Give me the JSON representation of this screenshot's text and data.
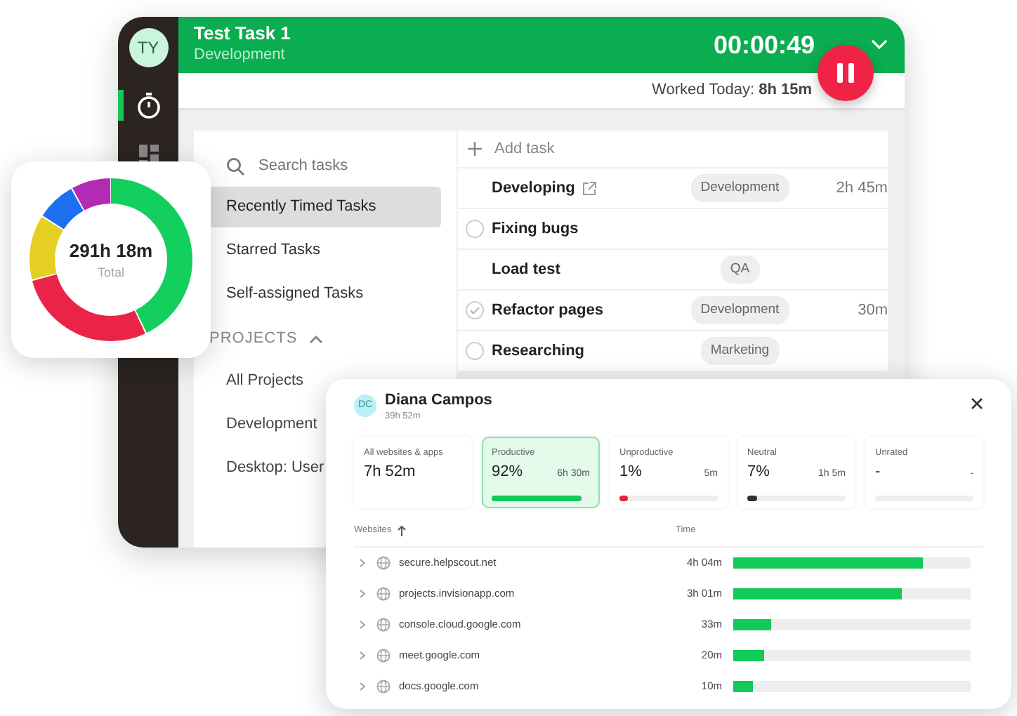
{
  "timer": {
    "avatar": "TY",
    "task": "Test Task 1",
    "project": "Development",
    "elapsed": "00:00:49",
    "worked_today": "Worked Today: **8h 15m**"
  },
  "search": {
    "placeholder": "Search tasks"
  },
  "task_filters": [
    {
      "label": "Recently Timed Tasks",
      "selected": true
    },
    {
      "label": "Starred Tasks",
      "selected": false
    },
    {
      "label": "Self-assigned Tasks",
      "selected": false
    }
  ],
  "projects": {
    "heading": "PROJECTS",
    "expanded": true,
    "items": [
      {
        "label": "All Projects"
      },
      {
        "label": "Development"
      },
      {
        "label": "Desktop: User"
      }
    ]
  },
  "add_task": "Add task",
  "tasks": [
    {
      "name": "Developing",
      "kind": "running",
      "tag": "Development",
      "time": "2h 45m"
    },
    {
      "name": "Fixing bugs",
      "kind": "todo"
    },
    {
      "name": "Load test",
      "kind": "plain",
      "tag": "QA"
    },
    {
      "name": "Refactor pages",
      "kind": "done",
      "tag": "Development",
      "time": "30m"
    },
    {
      "name": "Researching",
      "kind": "todo",
      "tag": "Marketing"
    }
  ],
  "summary": {
    "total": "291h 18m",
    "label": "Total"
  },
  "activity": {
    "avatar": "DC",
    "name": "Diana Campos",
    "hours": "39h 52m",
    "tiles": [
      {
        "label": "All websites & apps",
        "value": "7h 52m",
        "selected": false
      },
      {
        "label": "Productive",
        "value": "92%",
        "time": "6h 30m",
        "level": 0.92,
        "color": "#12c95a",
        "selected": true
      },
      {
        "label": "Unproductive",
        "value": "1%",
        "time": "5m",
        "level": 0.08,
        "color": "#e8213f",
        "selected": false
      },
      {
        "label": "Neutral",
        "value": "7%",
        "time": "1h 5m",
        "level": 0.1,
        "color": "#333333",
        "selected": false
      },
      {
        "label": "Unrated",
        "value": "-",
        "time": "-",
        "selected": false
      }
    ],
    "columns": [
      "Websites",
      "Time"
    ],
    "rows": [
      {
        "site": "secure.helpscout.net",
        "time": "4h 04m",
        "level": 0.8
      },
      {
        "site": "projects.invisionapp.com",
        "time": "3h 01m",
        "level": 0.71
      },
      {
        "site": "console.cloud.google.com",
        "time": "33m",
        "level": 0.16
      },
      {
        "site": "meet.google.com",
        "time": "20m",
        "level": 0.13
      },
      {
        "site": "docs.google.com",
        "time": "10m",
        "level": 0.08
      }
    ]
  }
}
